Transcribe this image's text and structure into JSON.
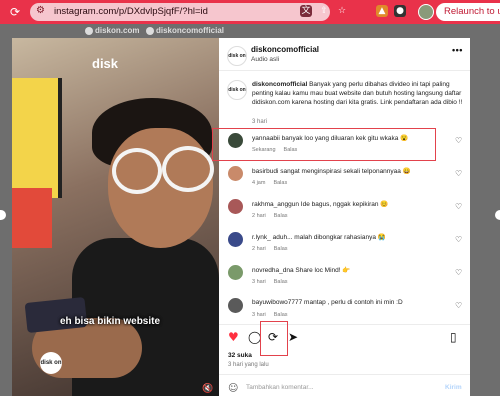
{
  "browser": {
    "url": "instagram.com/p/DXdvlpSjqfF/?hl=id",
    "relaunch_label": "Relaunch to upd"
  },
  "strip": {
    "left_label": "diskon.com",
    "right_label": "diskoncomofficial"
  },
  "video": {
    "watermark": "disk",
    "caption": "eh bisa bikin website",
    "logo_text": "disk on"
  },
  "post": {
    "username": "diskoncomofficial",
    "audio": "Audio asli",
    "avatar_text": "disk on",
    "caption_user": "diskoncomofficial",
    "caption_text": " Banyak yang perlu dibahas divideo ini tapi paling penting kalau kamu mau buat website dan butuh hosting langsung daftar didiskon.com karena hosting dari kita gratis. Link pendaftaran ada dibio !!",
    "caption_time": "3 hari",
    "likes": "32 suka",
    "time_ago": "3 hari yang lalu",
    "comment_placeholder": "Tambahkan komentar...",
    "post_label": "Kirim",
    "reply_label": "Balas"
  },
  "comments": [
    {
      "user": "yannaabii",
      "text": "banyak loo yang diluaran kek gitu wkaka 😮",
      "time": "Sekarang",
      "color": "#3a4a3a"
    },
    {
      "user": "basirbudi",
      "text": "sangat menginspirasi sekali telponannyaa 😄",
      "time": "4 jam",
      "color": "#c98a6a"
    },
    {
      "user": "rakhma_anggun",
      "text": "Ide bagus, nggak kepikiran 😊",
      "time": "2 hari",
      "color": "#a85858"
    },
    {
      "user": "r.lynk_",
      "text": "aduh... malah dibongkar rahasianya 😭",
      "time": "2 hari",
      "color": "#3a4a8a"
    },
    {
      "user": "novredha_dna",
      "text": "Share loc Mind! 👉",
      "time": "3 hari",
      "color": "#7a9a6a"
    },
    {
      "user": "bayuwibowo7777",
      "text": "mantap , perlu di contoh ini min :D",
      "time": "3 hari",
      "color": "#5a5a5a"
    }
  ]
}
